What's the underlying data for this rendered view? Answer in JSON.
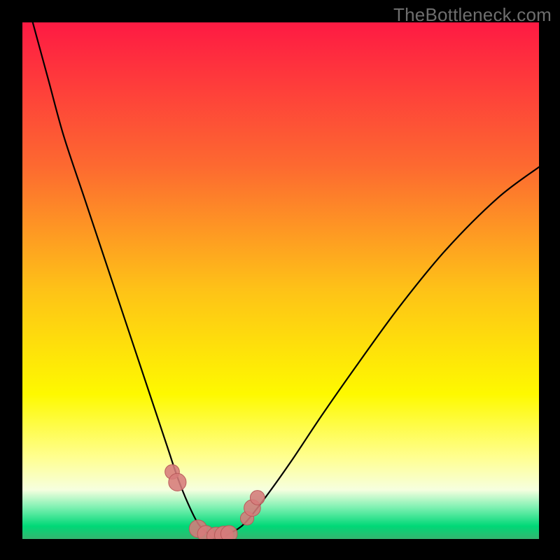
{
  "watermark": "TheBottleneck.com",
  "colors": {
    "frame": "#000000",
    "grad_top": "#fe1a43",
    "grad_mid1": "#fd8b2c",
    "grad_mid2": "#fef200",
    "grad_mid3": "#ffff8e",
    "grad_green": "#00e47a",
    "grad_bottom": "#34b66f",
    "curve": "#000000",
    "marker_fill": "#d67b7b",
    "marker_stroke": "#b95a5a"
  },
  "chart_data": {
    "type": "line",
    "title": "",
    "xlabel": "",
    "ylabel": "",
    "xlim": [
      0,
      100
    ],
    "ylim": [
      0,
      100
    ],
    "series": [
      {
        "name": "bottleneck-curve",
        "x": [
          2,
          5,
          8,
          12,
          16,
          20,
          24,
          28,
          30,
          32,
          34,
          36,
          37,
          38,
          40,
          43,
          47,
          52,
          58,
          65,
          73,
          82,
          92,
          100
        ],
        "y": [
          100,
          89,
          78,
          66,
          54,
          42,
          30,
          18,
          12,
          7,
          3,
          1,
          0,
          0,
          1,
          3,
          8,
          15,
          24,
          34,
          45,
          56,
          66,
          72
        ]
      }
    ],
    "markers": {
      "name": "highlight-region",
      "x": [
        29,
        30,
        34,
        35.5,
        37.5,
        39,
        40,
        43.5,
        44.5,
        45.5
      ],
      "y": [
        13,
        11,
        2,
        1,
        0.5,
        0.7,
        1,
        4,
        6,
        8
      ],
      "r": [
        1.4,
        1.7,
        1.7,
        1.6,
        1.8,
        1.8,
        1.6,
        1.3,
        1.6,
        1.4
      ]
    },
    "gradient_stops": [
      {
        "offset": 0.0,
        "color": "#fe1a43"
      },
      {
        "offset": 0.28,
        "color": "#fd6a30"
      },
      {
        "offset": 0.52,
        "color": "#fec317"
      },
      {
        "offset": 0.72,
        "color": "#fef900"
      },
      {
        "offset": 0.84,
        "color": "#ffff8e"
      },
      {
        "offset": 0.905,
        "color": "#f6ffdf"
      },
      {
        "offset": 0.94,
        "color": "#7af0b0"
      },
      {
        "offset": 0.975,
        "color": "#00d877"
      },
      {
        "offset": 1.0,
        "color": "#34b66f"
      }
    ]
  }
}
